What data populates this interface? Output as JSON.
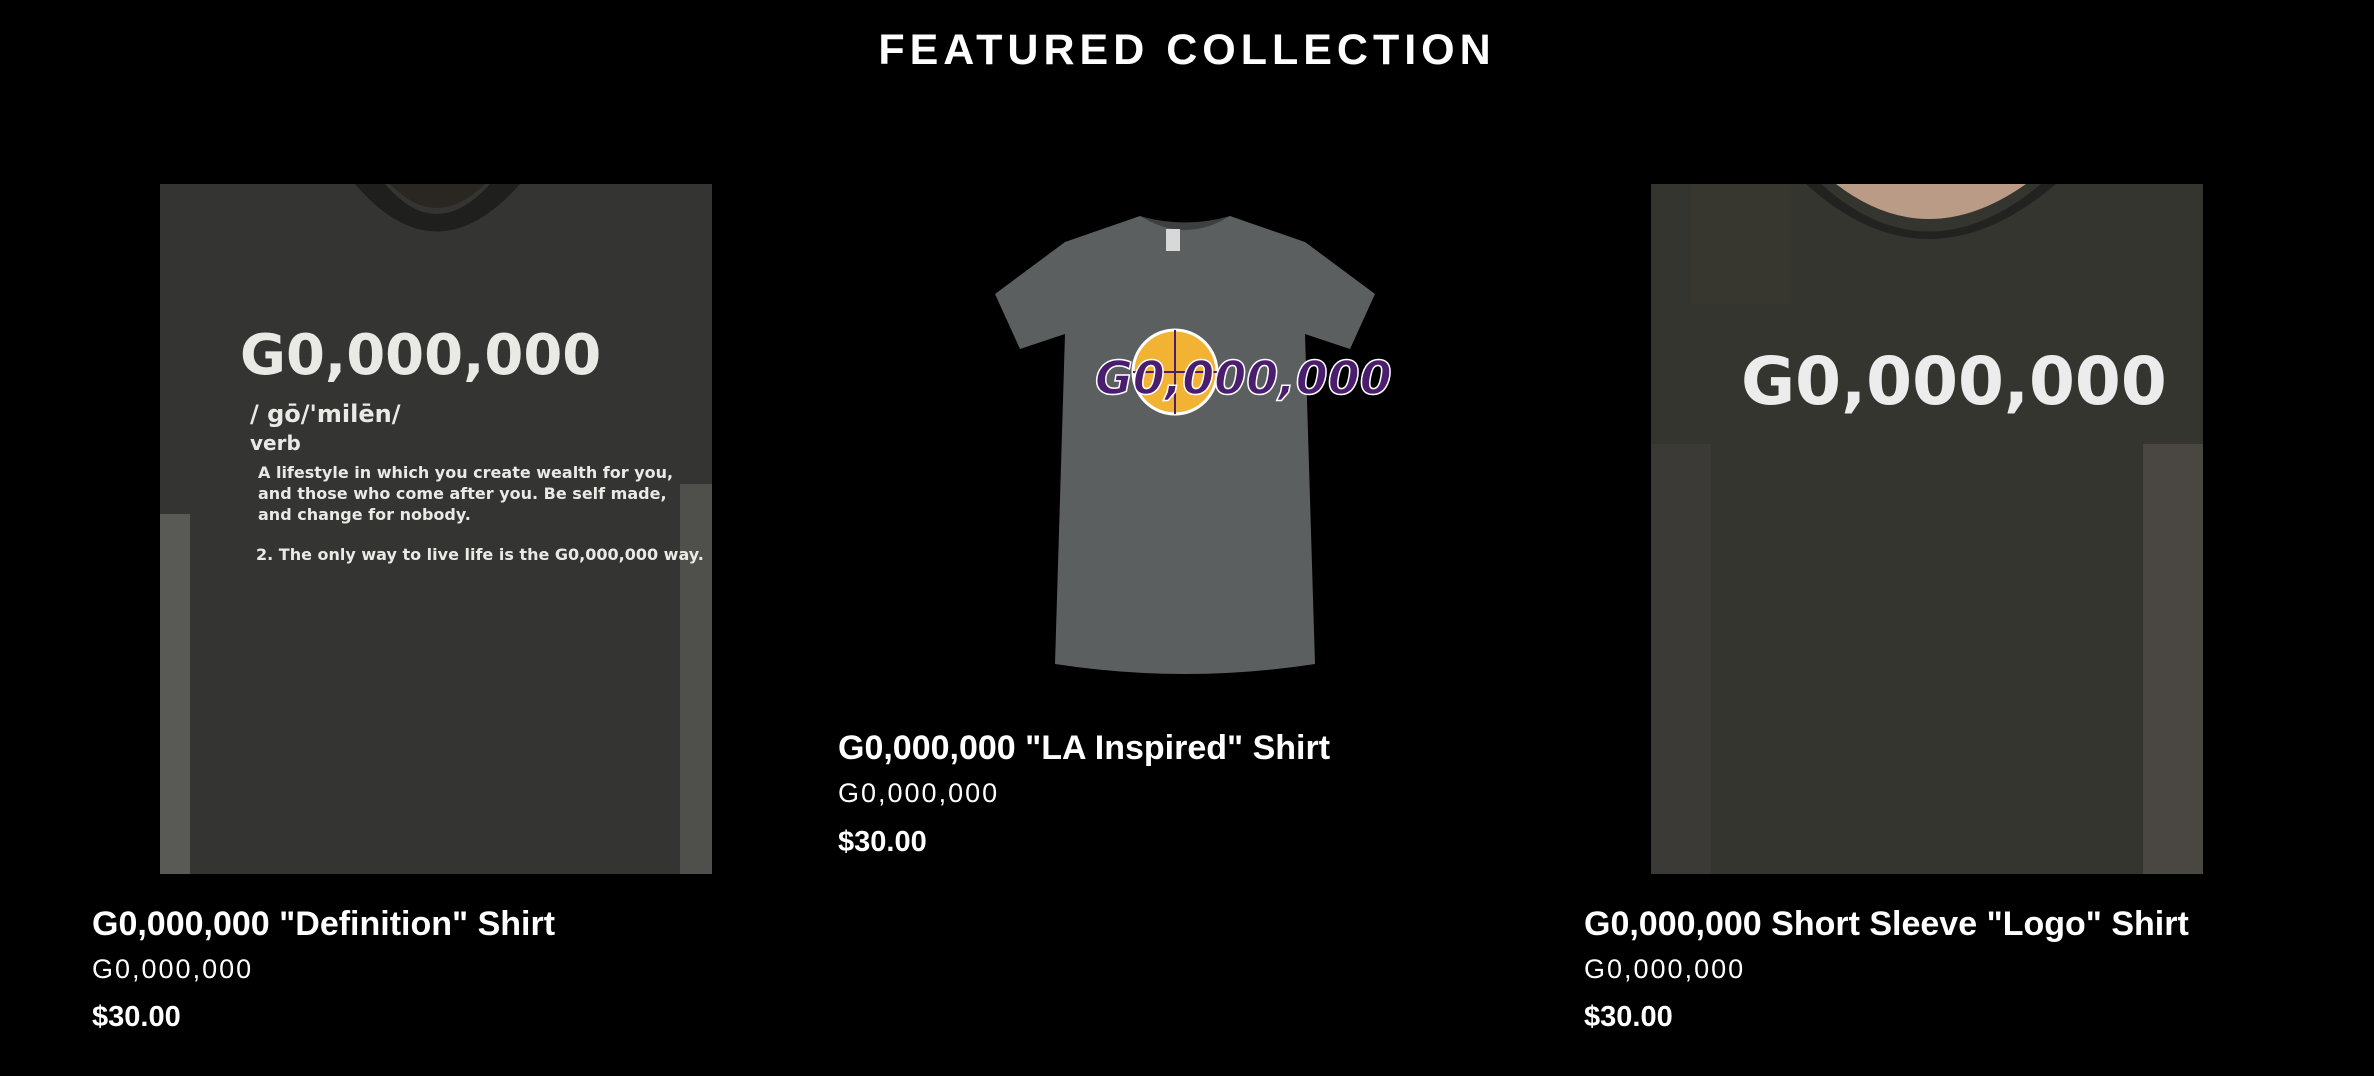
{
  "section": {
    "title": "FEATURED COLLECTION"
  },
  "products": [
    {
      "title": "G0,000,000 \"Definition\" Shirt",
      "vendor": "G0,000,000",
      "price": "$30.00",
      "image": {
        "icon": "definition-shirt-photo",
        "print_title": "G0,000,000",
        "phonetic": "/ gō/'milēn/",
        "part_of_speech": "verb",
        "def_1a": "A lifestyle in which you create wealth for you,",
        "def_1b": "and those who come after you. Be self made,",
        "def_1c": "and change for nobody.",
        "def_2": "2. The only way to live life is the G0,000,000 way."
      }
    },
    {
      "title": "G0,000,000 \"LA Inspired\" Shirt",
      "vendor": "G0,000,000",
      "price": "$30.00",
      "image": {
        "icon": "la-inspired-shirt-photo",
        "logo_text": "G0,000,000"
      }
    },
    {
      "title": "G0,000,000 Short Sleeve \"Logo\" Shirt",
      "vendor": "G0,000,000",
      "price": "$30.00",
      "image": {
        "icon": "logo-shirt-photo",
        "print_title": "G0,000,000"
      }
    }
  ],
  "colors": {
    "background": "#000000",
    "text": "#ffffff",
    "shirt_charcoal": "#3a3a3a",
    "shirt_heather": "#5b5f60",
    "logo_purple": "#4b1d6e",
    "logo_gold": "#f2b233"
  }
}
